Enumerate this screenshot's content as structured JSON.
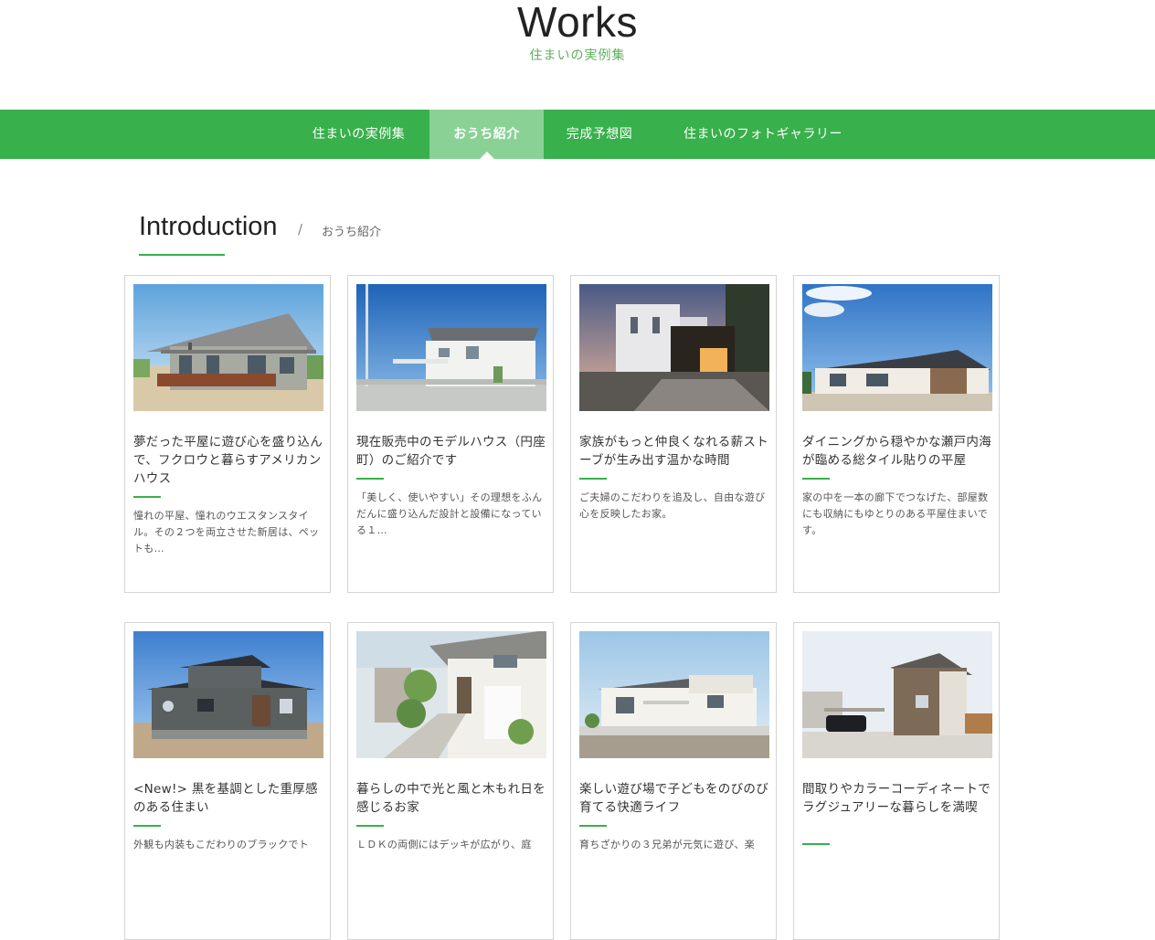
{
  "header": {
    "title": "Works",
    "subtitle": "住まいの実例集"
  },
  "nav": {
    "items": [
      {
        "label": "住まいの実例集",
        "active": false
      },
      {
        "label": "おうち紹介",
        "active": true
      },
      {
        "label": "完成予想図",
        "active": false
      },
      {
        "label": "住まいのフォトギャラリー",
        "active": false
      }
    ]
  },
  "section": {
    "title": "Introduction",
    "separator": "/",
    "subtitle": "おうち紹介"
  },
  "cards": [
    {
      "title": "夢だった平屋に遊び心を盛り込んで、フクロウと暮らすアメリカンハウス",
      "desc": "憧れの平屋、憧れのウエスタンスタイル。その２つを両立させた新居は、ペットも…"
    },
    {
      "title": "現在販売中のモデルハウス（円座町）のご紹介です",
      "desc": "「美しく、使いやすい」その理想をふんだんに盛り込んだ設計と設備になっている１…"
    },
    {
      "title": "家族がもっと仲良くなれる薪ストーブが生み出す温かな時間",
      "desc": "ご夫婦のこだわりを追及し、自由な遊び心を反映したお家。"
    },
    {
      "title": "ダイニングから穏やかな瀬戸内海が臨める総タイル貼りの平屋",
      "desc": "家の中を一本の廊下でつなげた、部屋数にも収納にもゆとりのある平屋住まいです。"
    },
    {
      "title": "<New!> 黒を基調とした重厚感のある住まい",
      "desc": "外観も内装もこだわりのブラックでト"
    },
    {
      "title": "暮らしの中で光と風と木もれ日を感じるお家",
      "desc": "ＬＤＫの両側にはデッキが広がり、庭"
    },
    {
      "title": "楽しい遊び場で子どもをのびのび育てる快適ライフ",
      "desc": "育ちざかりの３兄弟が元気に遊び、楽"
    },
    {
      "title": "間取りやカラーコーディネートでラグジュアリーな暮らしを満喫",
      "desc": ""
    }
  ]
}
